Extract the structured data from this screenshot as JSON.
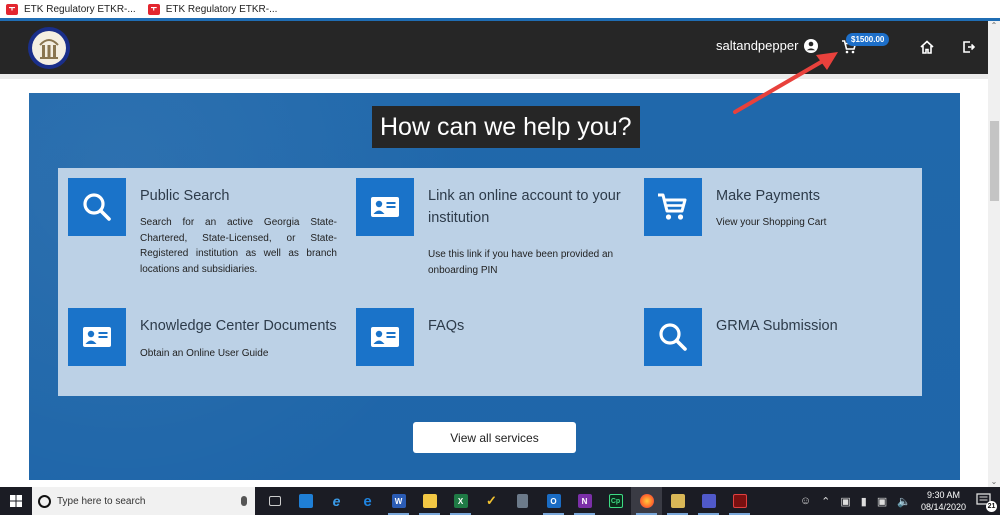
{
  "bookmarks": [
    {
      "label": "ETK Regulatory ETKR-..."
    },
    {
      "label": "ETK Regulatory ETKR-..."
    }
  ],
  "header": {
    "username": "saltandpepper",
    "cart_amount": "$1500.00"
  },
  "hero": {
    "title": "How can we help you?",
    "cards": [
      {
        "title": "Public Search",
        "desc": "Search for an active Georgia State-Chartered, State-Licensed, or State-Registered institution as well as branch locations and subsidiaries.",
        "icon": "search-icon"
      },
      {
        "title": "Link an online account to your institution",
        "desc": "Use this link if you have been provided an onboarding PIN",
        "icon": "id-card-icon"
      },
      {
        "title": "Make Payments",
        "desc": "View your Shopping Cart",
        "icon": "shopping-cart-icon"
      },
      {
        "title": "Knowledge Center Documents",
        "desc": "Obtain an Online User Guide",
        "icon": "id-card-icon"
      },
      {
        "title": "FAQs",
        "desc": "",
        "icon": "id-card-icon"
      },
      {
        "title": "GRMA Submission",
        "desc": "",
        "icon": "search-icon"
      }
    ],
    "view_all_label": "View all services"
  },
  "taskbar": {
    "search_placeholder": "Type here to search",
    "apps": [
      {
        "name": "task-view"
      },
      {
        "name": "people-app"
      },
      {
        "name": "internet-explorer"
      },
      {
        "name": "edge"
      },
      {
        "name": "word",
        "letter": "W"
      },
      {
        "name": "file-explorer"
      },
      {
        "name": "excel",
        "letter": "X"
      },
      {
        "name": "norton"
      },
      {
        "name": "calculator"
      },
      {
        "name": "outlook",
        "letter": "O"
      },
      {
        "name": "onenote",
        "letter": "N"
      },
      {
        "name": "captivate",
        "letter": "Cp"
      },
      {
        "name": "firefox"
      },
      {
        "name": "file-manager"
      },
      {
        "name": "teams"
      },
      {
        "name": "acrobat"
      }
    ],
    "time": "9:30 AM",
    "date": "08/14/2020",
    "notification_count": "21"
  },
  "colors": {
    "brand_blue": "#1f65a8",
    "icon_blue": "#1a73c9",
    "header_dark": "#262626",
    "annotation_arrow": "#e8413c"
  }
}
